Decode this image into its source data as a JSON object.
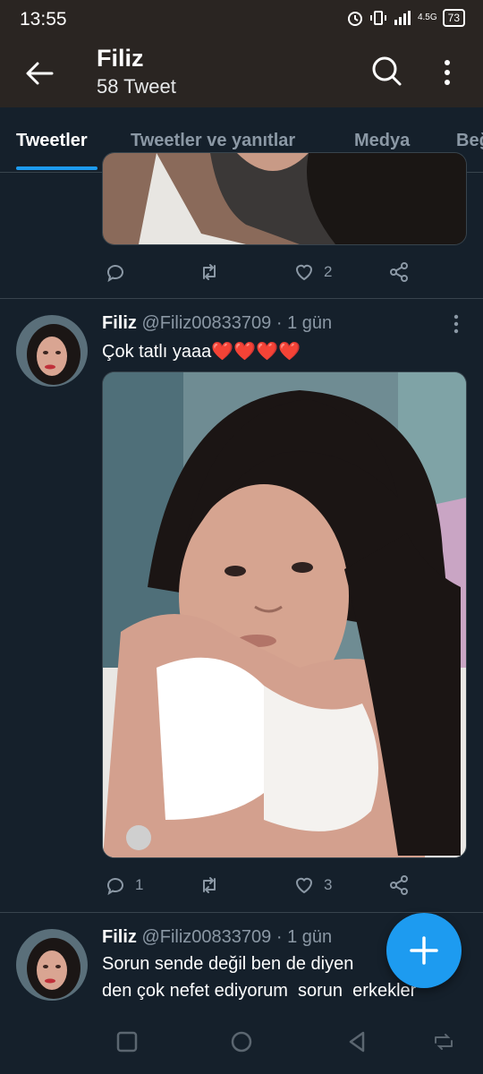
{
  "status_bar": {
    "time": "13:55",
    "network": "4.5G",
    "battery": "73"
  },
  "header": {
    "title": "Filiz",
    "subtitle": "58 Tweet"
  },
  "tabs": [
    {
      "label": "Tweetler",
      "active": true
    },
    {
      "label": "Tweetler ve yanıtlar",
      "active": false
    },
    {
      "label": "Medya",
      "active": false
    },
    {
      "label": "Beğ",
      "active": false
    }
  ],
  "tweets": [
    {
      "reply_count": "",
      "like_count": "2"
    },
    {
      "name": "Filiz",
      "handle": "@Filiz00833709",
      "time": "· 1 gün",
      "text": "Çok tatlı yaaa❤️❤️❤️❤️",
      "reply_count": "1",
      "like_count": "3"
    },
    {
      "name": "Filiz",
      "handle": "@Filiz00833709",
      "time": "· 1 gün",
      "text_line1": "Sorun sende değil ben de diyen",
      "text_line2": "den çok nefet ediyorum  sorun  erkekler"
    }
  ],
  "colors": {
    "accent": "#1d9bf0",
    "background": "#15202b",
    "header": "#2a2522",
    "heart": "#e0245e"
  },
  "icons": [
    "back-arrow-icon",
    "search-icon",
    "more-vertical-icon",
    "reply-icon",
    "retweet-icon",
    "like-icon",
    "share-icon",
    "plus-icon",
    "nav-square-icon",
    "nav-circle-icon",
    "nav-back-icon",
    "nav-rotate-icon"
  ]
}
